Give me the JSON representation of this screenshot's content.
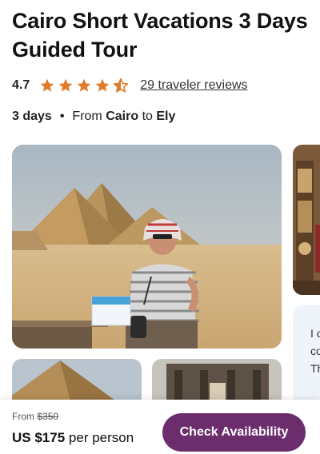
{
  "tour": {
    "title": "Cairo Short Vacations 3 Days Guided Tour",
    "rating": "4.7",
    "stars": {
      "count": 5,
      "value": 4.5,
      "color": "#e07b2a",
      "icon": "star-icon"
    },
    "reviews_link": "29 traveler reviews",
    "duration": "3 days",
    "from_label": "From",
    "from_city": "Cairo",
    "to_label": "to",
    "to_city": "Ely"
  },
  "gallery": {
    "hero_alt": "Tourist with guide book in front of Giza pyramids",
    "side_card_lines": [
      "I c",
      "co",
      "Th"
    ]
  },
  "booking": {
    "from_prefix": "From",
    "original_price": "$350",
    "price": "US $175",
    "per_unit": "per person",
    "cta_label": "Check Availability",
    "cta_color": "#6b2d6b"
  }
}
